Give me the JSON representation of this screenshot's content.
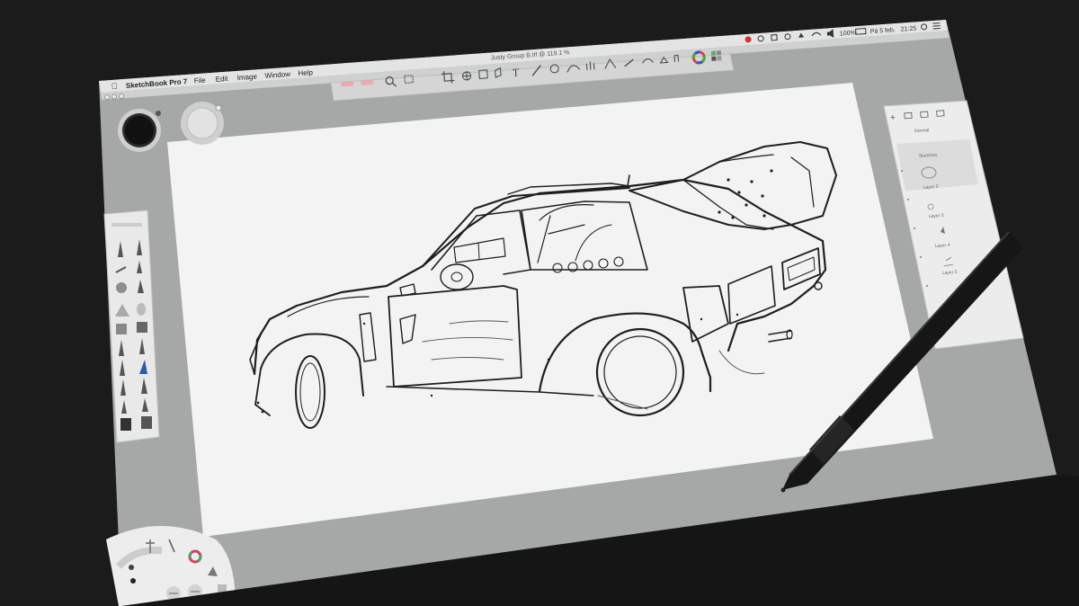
{
  "menubar": {
    "app_name": "SketchBook Pro 7",
    "items": [
      "File",
      "Edit",
      "Image",
      "Window",
      "Help"
    ]
  },
  "status": {
    "battery": "100%",
    "date": "Pá 5 feb.",
    "time": "21:25"
  },
  "document": {
    "title": "Justy Group B.tif @ 119.1 %"
  },
  "layers": {
    "blend_mode": "Normal",
    "items": [
      "Sketches",
      "Layer 2",
      "Layer 3",
      "Layer 4",
      "Layer 5"
    ]
  },
  "colors": {
    "menubar": "#e6e6e6",
    "toolbar": "#d2d2d2",
    "workspace": "#a7a9a9",
    "canvas": "#f3f3f3",
    "ink": "#1e1e1e",
    "stylus": "#1a1a1a"
  }
}
